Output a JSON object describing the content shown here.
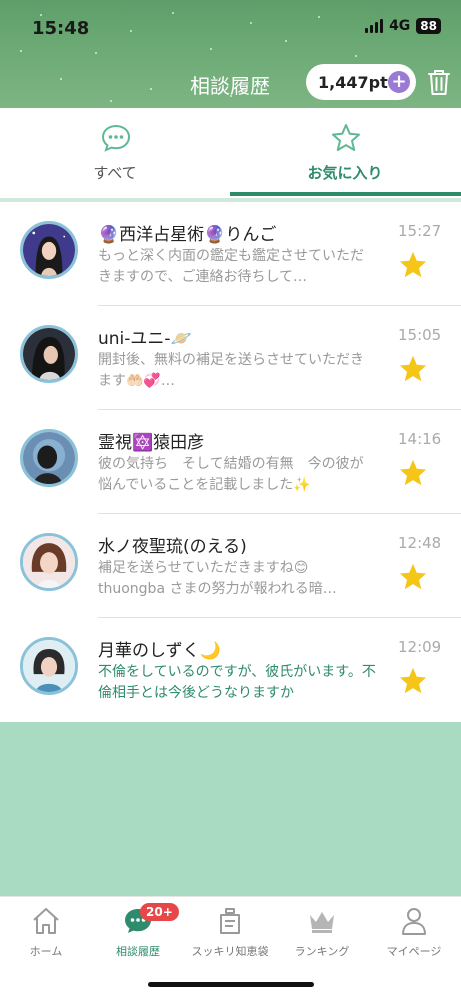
{
  "status_bar": {
    "time": "15:48",
    "network": "4G",
    "battery": "88"
  },
  "header": {
    "title": "相談履歴",
    "points": "1,447pt",
    "add_points_icon": "plus-icon",
    "delete_icon": "trash-icon"
  },
  "tabs": [
    {
      "label": "すべて",
      "icon": "chat-bubble-icon",
      "active": false
    },
    {
      "label": "お気に入り",
      "icon": "star-outline-icon",
      "active": true
    }
  ],
  "conversations": [
    {
      "name": "🔮西洋占星術🔮りんご",
      "time": "15:27",
      "preview": "もっと深く内面の鑑定も鑑定させていただきますので、ご連絡お待ちして…",
      "unread": false,
      "favorite": true
    },
    {
      "name": "uni-ユニ-🪐",
      "time": "15:05",
      "preview": "開封後、無料の補足を送らさせていただきます🤲🏻💞…",
      "unread": false,
      "favorite": true
    },
    {
      "name": "霊視🔯猿田彦",
      "time": "14:16",
      "preview": "彼の気持ち　そして結婚の有無　今の彼が悩んでいることを記載しました✨",
      "unread": false,
      "favorite": true
    },
    {
      "name": "水ノ夜聖琉(のえる)",
      "time": "12:48",
      "preview": "補足を送らせていただきますね😊 thuongba さまの努力が報われる暗…",
      "unread": false,
      "favorite": true
    },
    {
      "name": "月華のしずく🌙",
      "time": "12:09",
      "preview": "不倫をしているのですが、彼氏がいます。不倫相手とは今後どうなりますか",
      "unread": true,
      "favorite": true
    }
  ],
  "bottom_nav": [
    {
      "label": "ホーム",
      "icon": "home-icon",
      "active": false
    },
    {
      "label": "相談履歴",
      "icon": "chat-icon",
      "active": true,
      "badge": "20+"
    },
    {
      "label": "スッキリ知恵袋",
      "icon": "bag-icon",
      "active": false
    },
    {
      "label": "ランキング",
      "icon": "crown-icon",
      "active": false
    },
    {
      "label": "マイページ",
      "icon": "person-icon",
      "active": false
    }
  ],
  "colors": {
    "accent": "#2e8b6b",
    "header_green": "#6fac78",
    "star": "#f5c518",
    "badge": "#e8474a",
    "background": "#a9dbc3"
  }
}
